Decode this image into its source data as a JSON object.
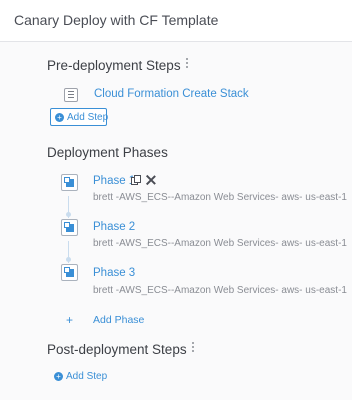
{
  "panel": {
    "title": "Canary Deploy with CF Template"
  },
  "pre_deployment": {
    "title": "Pre-deployment Steps",
    "steps": [
      {
        "label": "Cloud Formation Create Stack"
      }
    ],
    "add_step_label": "Add Step"
  },
  "deployment_phases": {
    "title": "Deployment Phases",
    "phases": [
      {
        "name": "Phase 1",
        "description": "brett -AWS_ECS--Amazon Web Services- aws- us-east-1"
      },
      {
        "name": "Phase 2",
        "description": "brett -AWS_ECS--Amazon Web Services- aws- us-east-1"
      },
      {
        "name": "Phase 3",
        "description": "brett -AWS_ECS--Amazon Web Services- aws- us-east-1"
      }
    ],
    "add_phase_label": "Add Phase",
    "add_phase_symbol": "+"
  },
  "post_deployment": {
    "title": "Post-deployment Steps",
    "add_step_label": "Add Step"
  },
  "colors": {
    "accent": "#3a8fd6",
    "text": "#3c3f45",
    "muted": "#8a8d94"
  }
}
